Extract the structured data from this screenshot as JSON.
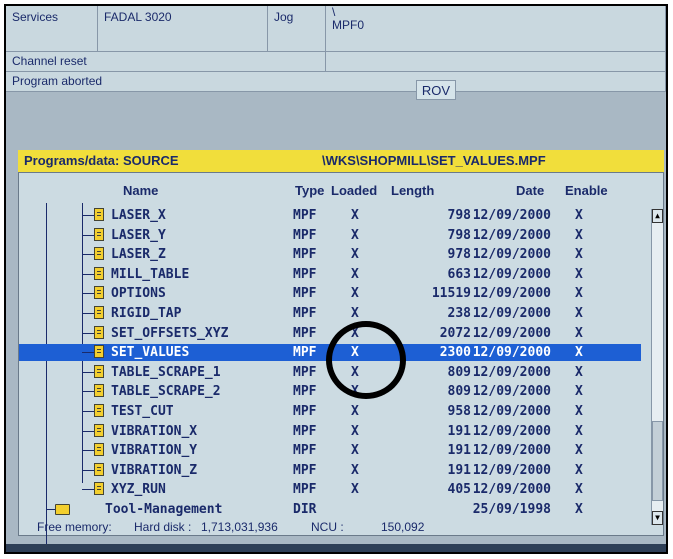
{
  "status_panel": {
    "area": "Services",
    "machine": "FADAL 3020",
    "mode": "Jog",
    "path_prefix": "\\",
    "program": "MPF0",
    "channel_status": "Channel reset",
    "program_status": "Program aborted",
    "rov_label": "ROV"
  },
  "programs": {
    "header_left": "Programs/data: SOURCE",
    "header_path": "\\WKS\\SHOPMILL\\SET_VALUES.MPF",
    "columns": {
      "name": "Name",
      "type": "Type",
      "loaded": "Loaded",
      "length": "Length",
      "date": "Date",
      "enable": "Enable"
    },
    "rows": [
      {
        "name": "LASER_X",
        "type": "MPF",
        "loaded": "X",
        "length": "798",
        "date": "12/09/2000",
        "enable": "X"
      },
      {
        "name": "LASER_Y",
        "type": "MPF",
        "loaded": "X",
        "length": "798",
        "date": "12/09/2000",
        "enable": "X"
      },
      {
        "name": "LASER_Z",
        "type": "MPF",
        "loaded": "X",
        "length": "978",
        "date": "12/09/2000",
        "enable": "X"
      },
      {
        "name": "MILL_TABLE",
        "type": "MPF",
        "loaded": "X",
        "length": "663",
        "date": "12/09/2000",
        "enable": "X"
      },
      {
        "name": "OPTIONS",
        "type": "MPF",
        "loaded": "X",
        "length": "11519",
        "date": "12/09/2000",
        "enable": "X"
      },
      {
        "name": "RIGID_TAP",
        "type": "MPF",
        "loaded": "X",
        "length": "238",
        "date": "12/09/2000",
        "enable": "X"
      },
      {
        "name": "SET_OFFSETS_XYZ",
        "type": "MPF",
        "loaded": "X",
        "length": "2072",
        "date": "12/09/2000",
        "enable": "X"
      },
      {
        "name": "SET_VALUES",
        "type": "MPF",
        "loaded": "X",
        "length": "2300",
        "date": "12/09/2000",
        "enable": "X",
        "selected": true
      },
      {
        "name": "TABLE_SCRAPE_1",
        "type": "MPF",
        "loaded": "X",
        "length": "809",
        "date": "12/09/2000",
        "enable": "X"
      },
      {
        "name": "TABLE_SCRAPE_2",
        "type": "MPF",
        "loaded": "X",
        "length": "809",
        "date": "12/09/2000",
        "enable": "X"
      },
      {
        "name": "TEST_CUT",
        "type": "MPF",
        "loaded": "X",
        "length": "958",
        "date": "12/09/2000",
        "enable": "X"
      },
      {
        "name": "VIBRATION_X",
        "type": "MPF",
        "loaded": "X",
        "length": "191",
        "date": "12/09/2000",
        "enable": "X"
      },
      {
        "name": "VIBRATION_Y",
        "type": "MPF",
        "loaded": "X",
        "length": "191",
        "date": "12/09/2000",
        "enable": "X"
      },
      {
        "name": "VIBRATION_Z",
        "type": "MPF",
        "loaded": "X",
        "length": "191",
        "date": "12/09/2000",
        "enable": "X"
      },
      {
        "name": "XYZ_RUN",
        "type": "MPF",
        "loaded": "X",
        "length": "405",
        "date": "12/09/2000",
        "enable": "X"
      },
      {
        "name": "Tool-Management",
        "type": "DIR",
        "loaded": "",
        "length": "",
        "date": "25/09/1998",
        "enable": "X",
        "folder": true
      }
    ]
  },
  "footer": {
    "free_memory_label": "Free memory:",
    "hard_disk_label": "Hard disk :",
    "hard_disk_value": "1,713,031,936",
    "ncu_label": "NCU :",
    "ncu_value": "150,092"
  },
  "colors": {
    "header_yellow": "#f1de3b",
    "selection_blue": "#1d5fd4",
    "screen_bg": "#a9b8c4",
    "text_navy": "#1a2a6a"
  }
}
